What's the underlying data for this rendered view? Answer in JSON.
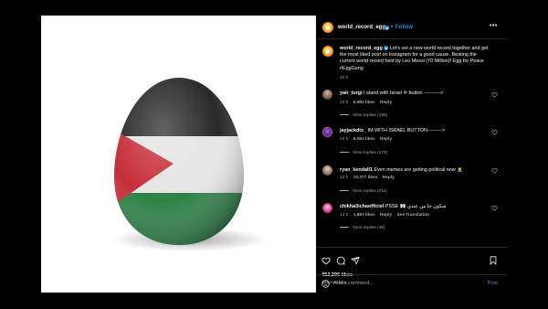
{
  "post": {
    "username": "world_record_egg",
    "follow_label": "Follow",
    "separator": "•",
    "more_label": "•••"
  },
  "caption": {
    "username": "world_record_egg",
    "text": "Let’s set a new world record together and get the most liked post on Instagram for a good cause. Beating the current world record held by Leo Messi (70 Million)! Egg for Peace",
    "hashtag": "#EggGang",
    "time": "14 h"
  },
  "comments": [
    {
      "username": "yair_turgi",
      "text": "I stand with Israel ✡ button ---------->",
      "time": "14 h",
      "likes": "6,963 likes",
      "reply_label": "Reply",
      "view_replies": "View replies (195)"
    },
    {
      "username": "jayjackdtx_",
      "text": "IM WITH ISRAEL BUTTON--------->",
      "time": "14 h",
      "likes": "8,053 likes",
      "reply_label": "Reply",
      "view_replies": "View replies (172)"
    },
    {
      "username": "ryan_kendall1",
      "text": "Even memes are getting political now 🤦‍♂️",
      "time": "14 h",
      "likes": "10,377 likes",
      "reply_label": "Reply",
      "view_replies": "View replies (211)"
    },
    {
      "username": "chikha3ichaofficiel",
      "text": "PSSE 👀 شكون جا من عندي",
      "time": "14 h",
      "likes": "1,887 likes",
      "reply_label": "Reply",
      "translation_label": "See Translation",
      "view_replies": "View replies (48)"
    }
  ],
  "actions": {
    "likes": "453,396 likes",
    "time_ago": "14 hours ago"
  },
  "add_comment": {
    "placeholder": "Add a comment...",
    "post_label": "Post"
  },
  "colors": {
    "background": "#000000",
    "accent": "#0095f6",
    "flag_black": "#1a1a1a",
    "flag_white": "#ececec",
    "flag_green": "#1d7a3a",
    "flag_red": "#c8202b"
  },
  "image": {
    "subject": "egg painted with Palestinian flag"
  }
}
